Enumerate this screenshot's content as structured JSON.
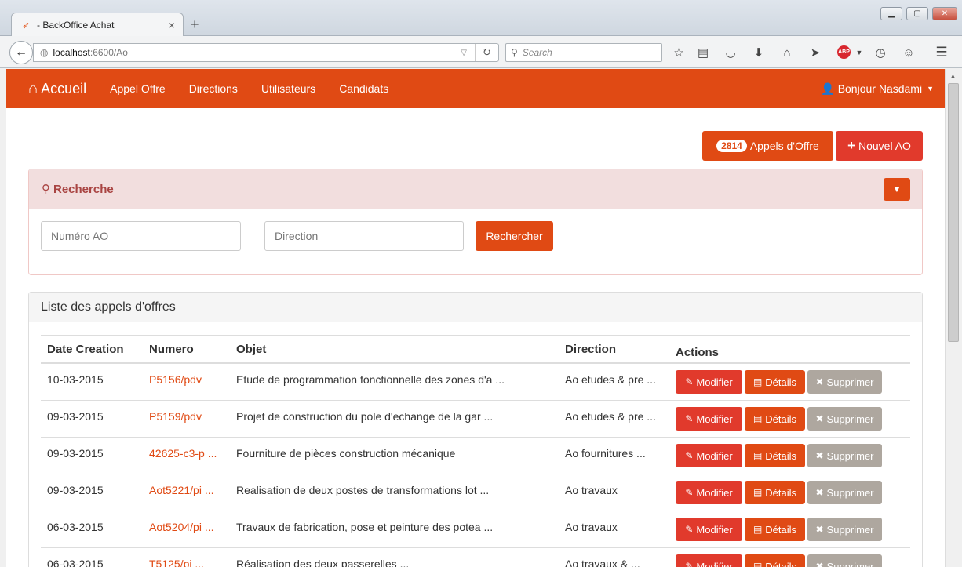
{
  "browser": {
    "tab_title": "- BackOffice Achat",
    "tab_close": "×",
    "new_tab": "+",
    "url_host": "localhost",
    "url_path": ":6600/Ao",
    "search_placeholder": "Search"
  },
  "nav": {
    "brand": "Accueil",
    "links": [
      "Appel Offre",
      "Directions",
      "Utilisateurs",
      "Candidats"
    ],
    "user": "Bonjour Nasdami"
  },
  "toolbar": {
    "count": "2814",
    "count_label": "Appels d'Offre",
    "new_label": "Nouvel AO"
  },
  "search": {
    "title": "Recherche",
    "numero_placeholder": "Numéro AO",
    "direction_placeholder": "Direction",
    "button": "Rechercher"
  },
  "list": {
    "title": "Liste des appels d'offres",
    "columns": [
      "Date Creation",
      "Numero",
      "Objet",
      "Direction",
      "Actions"
    ],
    "actions": {
      "modify": "Modifier",
      "details": "Détails",
      "delete": "Supprimer"
    },
    "rows": [
      {
        "date": "10-03-2015",
        "numero": "P5156/pdv",
        "objet": "Etude de programmation fonctionnelle des zones d'a ...",
        "direction": "Ao etudes & pre ..."
      },
      {
        "date": "09-03-2015",
        "numero": "P5159/pdv",
        "objet": "Projet de construction du pole d'echange de la gar ...",
        "direction": "Ao etudes & pre ..."
      },
      {
        "date": "09-03-2015",
        "numero": "42625-c3-p ...",
        "objet": "Fourniture de pièces construction mécanique",
        "direction": "Ao fournitures ..."
      },
      {
        "date": "09-03-2015",
        "numero": "Aot5221/pi ...",
        "objet": "Realisation de deux postes de transformations lot ...",
        "direction": "Ao travaux"
      },
      {
        "date": "06-03-2015",
        "numero": "Aot5204/pi ...",
        "objet": "Travaux de fabrication, pose et peinture des potea ...",
        "direction": "Ao travaux"
      },
      {
        "date": "06-03-2015",
        "numero": "T5125/pi ...",
        "objet": "Réalisation des deux passerelles ...",
        "direction": "Ao travaux & ..."
      }
    ]
  },
  "colors": {
    "accent": "#e04a14",
    "danger": "#e13a2c",
    "muted": "#aea79f"
  }
}
